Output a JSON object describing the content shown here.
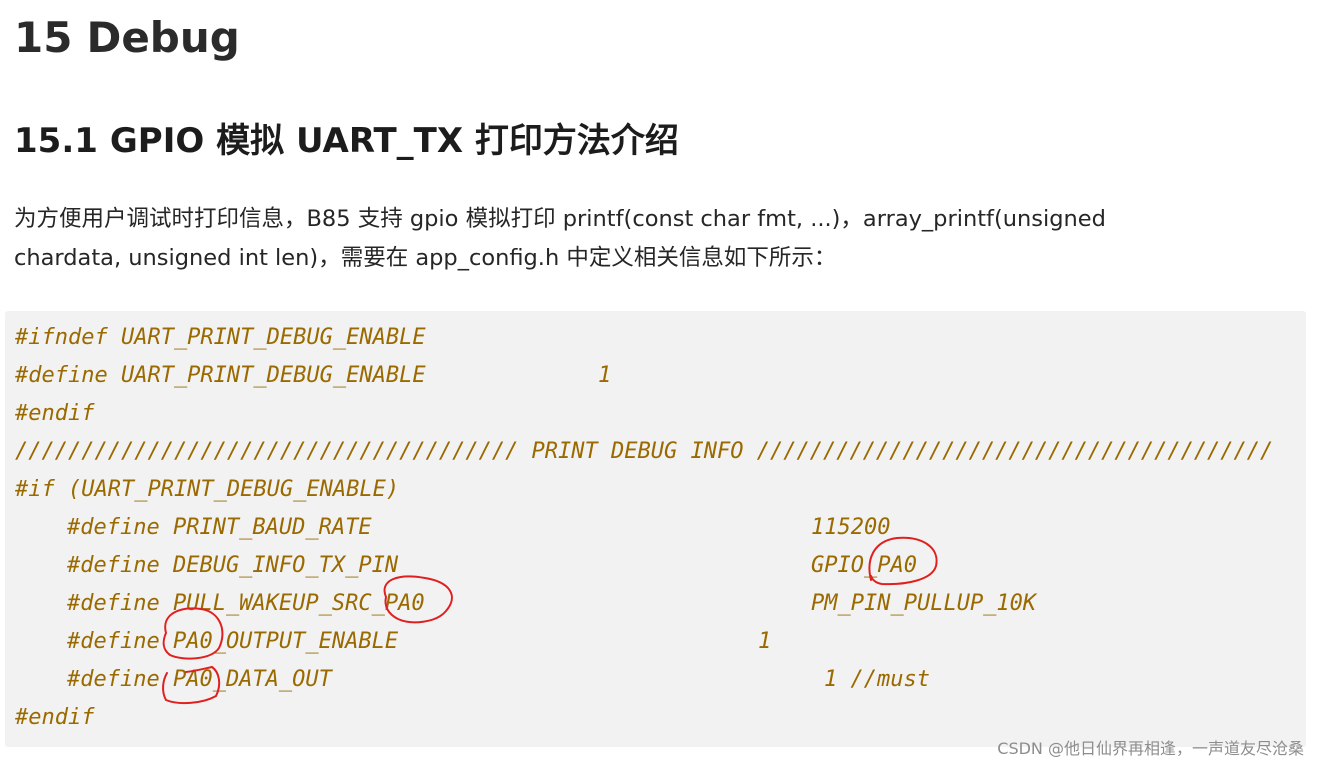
{
  "heading1": {
    "number": "15",
    "title": "Debug"
  },
  "heading2": {
    "number": "15.1",
    "title": "GPIO 模拟 UART_TX 打印方法介绍"
  },
  "paragraph": {
    "line1": "为方便用户调试时打印信息，B85 支持 gpio 模拟打印 printf(const char fmt, ...)，array_printf(unsigned",
    "line2": "chardata, unsigned int len)，需要在 app_config.h 中定义相关信息如下所示："
  },
  "code": {
    "lines": [
      "#ifndef UART_PRINT_DEBUG_ENABLE",
      "#define UART_PRINT_DEBUG_ENABLE",
      "1",
      "#endif",
      "////////////////////////////////////// PRINT DEBUG INFO ///////////////////////////////////////",
      "#if (UART_PRINT_DEBUG_ENABLE)",
      "#define PRINT_BAUD_RATE",
      "115200",
      "#define DEBUG_INFO_TX_PIN",
      "GPIO_PA0",
      "#define PULL_WAKEUP_SRC_PA0",
      "PM_PIN_PULLUP_10K",
      "#define PA0_OUTPUT_ENABLE",
      "1",
      "#define PA0_DATA_OUT",
      "1 //must",
      "#endif"
    ]
  },
  "watermark": "CSDN @他日仙界再相逢，一声道友尽沧桑",
  "colors": {
    "code_text": "#9a6a00",
    "code_background": "#f2f2f2",
    "annotation_circles": "#e02020"
  }
}
